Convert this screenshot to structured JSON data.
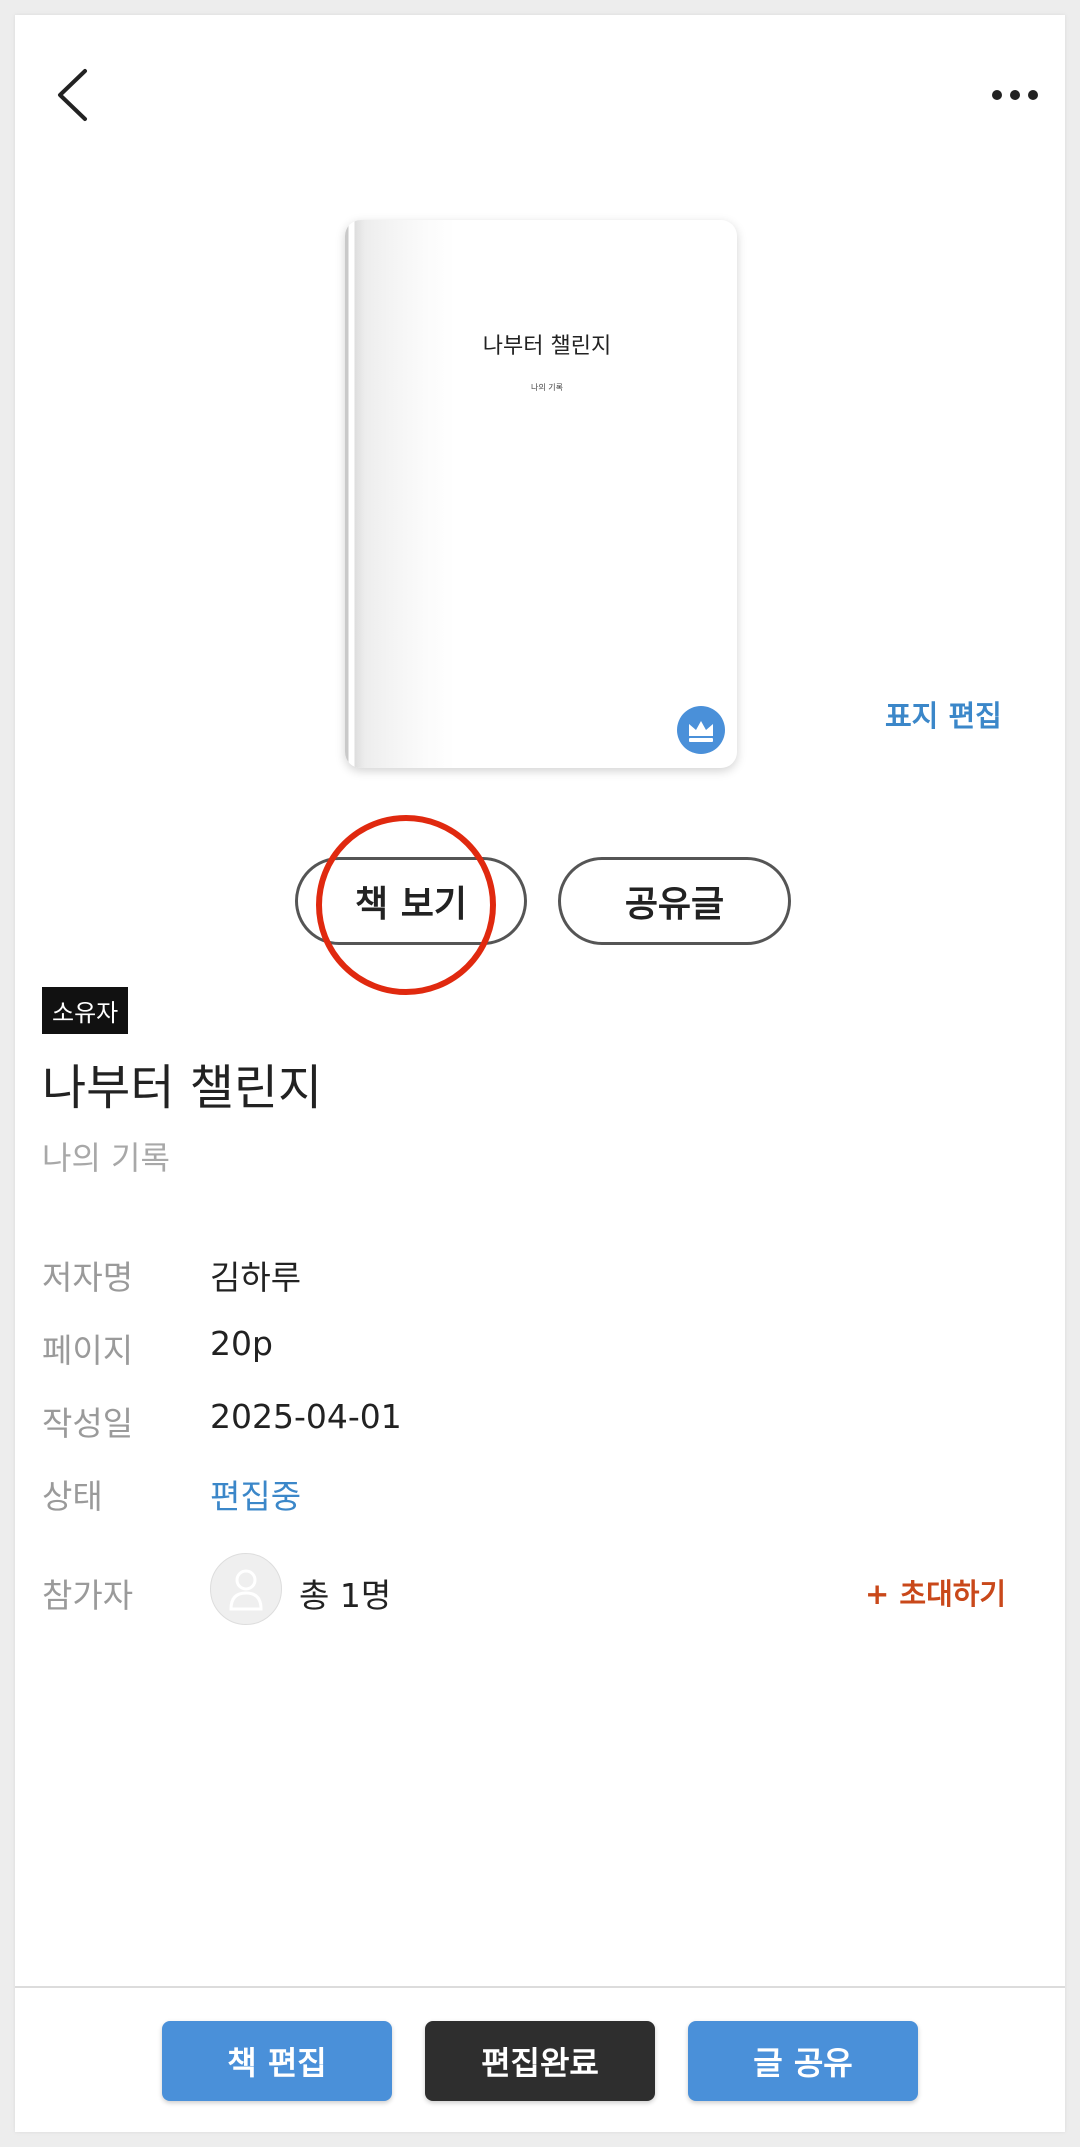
{
  "header": {
    "back_icon": "chevron-left-icon",
    "more_icon": "more-horizontal-icon"
  },
  "cover": {
    "title": "나부터 챌린지",
    "subtitle": "나의 기록",
    "badge_icon": "crown-icon",
    "badge_color": "#4a90d9",
    "edit_label": "표지 편집"
  },
  "actions": {
    "view_book": "책 보기",
    "shared_posts": "공유글",
    "highlight_color": "#e0290f"
  },
  "book": {
    "owner_badge": "소유자",
    "title": "나부터 챌린지",
    "subtitle": "나의 기록"
  },
  "details": [
    {
      "label": "저자명",
      "value": "김하루"
    },
    {
      "label": "페이지",
      "value": "20p"
    },
    {
      "label": "작성일",
      "value": "2025-04-01"
    },
    {
      "label": "상태",
      "value": "편집중"
    }
  ],
  "participants": {
    "label": "참가자",
    "count_text": "총 1명",
    "invite_label": "+ 초대하기",
    "avatar_icon": "user-icon"
  },
  "bottom_bar": {
    "edit_book": "책 편집",
    "finish_edit": "편집완료",
    "share_post": "글 공유"
  },
  "colors": {
    "accent_blue": "#4a90d9",
    "link_blue": "#3b87c9",
    "invite_orange": "#c9481a",
    "dark_button": "#2e2e2e"
  }
}
